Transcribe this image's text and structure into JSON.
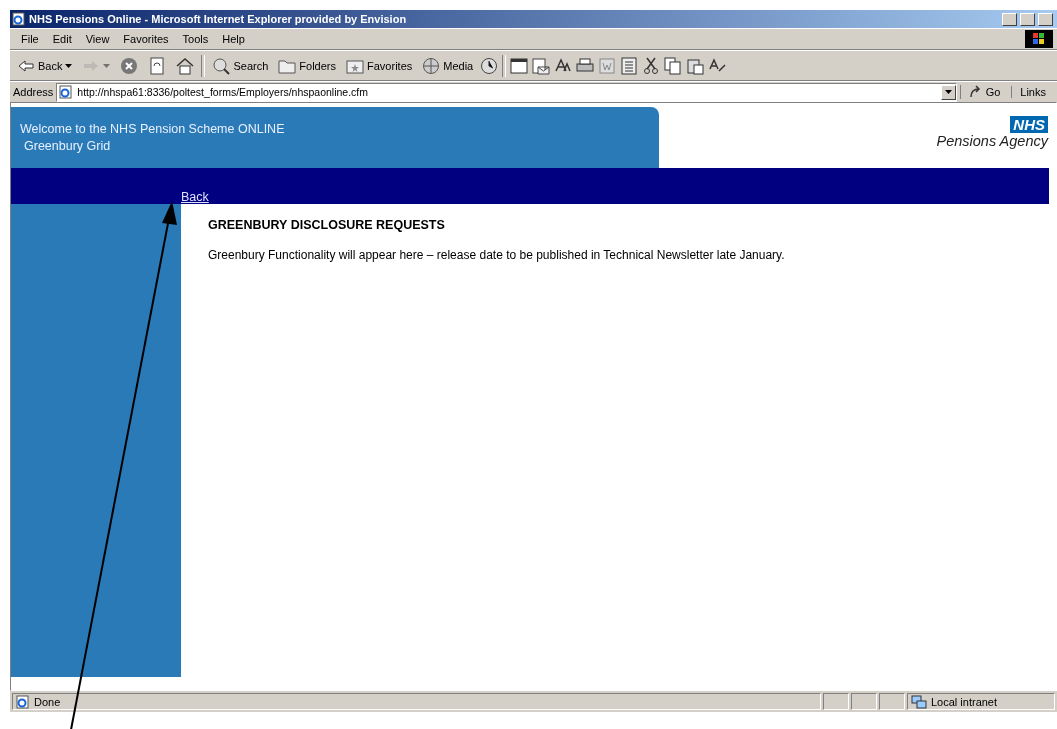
{
  "window": {
    "title": "NHS Pensions Online - Microsoft Internet Explorer provided by Envision"
  },
  "menu": [
    "File",
    "Edit",
    "View",
    "Favorites",
    "Tools",
    "Help"
  ],
  "toolbar": [
    {
      "label": "Back",
      "dropdown": true,
      "disabled": false
    },
    {
      "dropdown": true,
      "disabled": true
    },
    {
      "disabled": false
    },
    {
      "disabled": false
    },
    {
      "disabled": false
    },
    {
      "label": "Search",
      "disabled": false
    },
    {
      "label": "Folders",
      "disabled": false
    },
    {
      "label": "Favorites",
      "disabled": false
    },
    {
      "label": "Media",
      "disabled": false
    }
  ],
  "address": {
    "label": "Address",
    "url": "http://nhspa61:8336/poltest_forms/Employers/nhspaonline.cfm",
    "go": "Go",
    "links": "Links"
  },
  "page": {
    "welcome": "Welcome to the NHS Pension Scheme ONLINE",
    "subtitle": "Greenbury Grid",
    "logo_mark": "NHS",
    "logo_text": "Pensions Agency",
    "back_link": "Back",
    "heading": "GREENBURY DISCLOSURE REQUESTS",
    "message": "Greenbury Functionality will appear here – release date to be published in Technical Newsletter late January."
  },
  "status_bar": {
    "text": "Done",
    "zone": "Local intranet"
  }
}
